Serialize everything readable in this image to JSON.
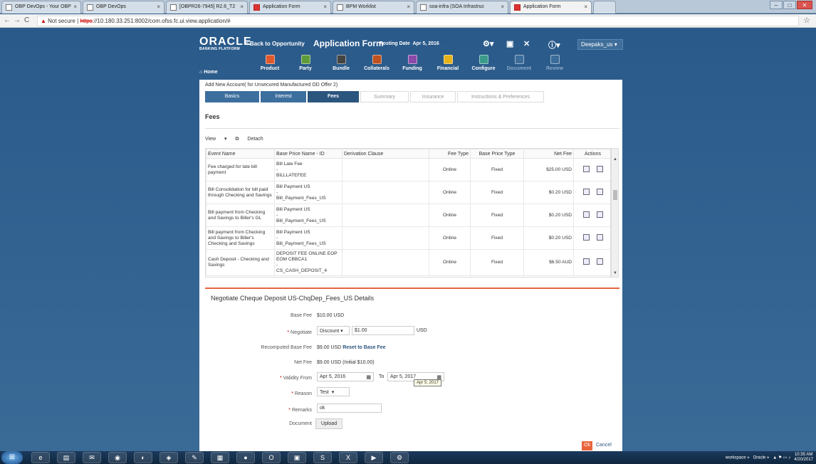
{
  "browser": {
    "tabs": [
      {
        "label": "OBP DevOps - Your OBP"
      },
      {
        "label": "OBP DevOps"
      },
      {
        "label": "[OBPR26-7945] R2.6_T2"
      },
      {
        "label": "Application Form"
      },
      {
        "label": "BPM Worklist"
      },
      {
        "label": "soa-infra (SOA Infrastruc"
      },
      {
        "label": "Application Form"
      }
    ],
    "not_secure": "Not secure",
    "url_scheme": "https",
    "url_rest": "://10.180.33.251:8002/com.ofss.fc.ui.view.application/#"
  },
  "header": {
    "logo": "ORACLE",
    "logo_sub": "BANKING PLATFORM",
    "back": "Back to Opportunity",
    "title": "Application Form",
    "posting_label": "Posting Date",
    "posting_date": "Apr 5, 2016",
    "user": "Deepaks_us",
    "home": "Home",
    "nav": [
      "Product",
      "Party",
      "Bundle",
      "Collaterals",
      "Funding",
      "Financial",
      "Configure",
      "Document",
      "Review"
    ]
  },
  "page": {
    "subheading": "Add New Account( for Unsecured Manufactured OD Offer 2)",
    "steps": [
      "Basics",
      "Interest",
      "Fees",
      "Summary",
      "Insurance",
      "Instructions & Preferences"
    ],
    "section_title": "Fees",
    "toolbar": {
      "view": "View",
      "detach": "Detach"
    }
  },
  "table": {
    "columns": [
      "Event Name",
      "Base Price Name - ID",
      "Derivation Clause",
      "Fee Type",
      "Base Price Type",
      "Net Fee",
      "Actions"
    ],
    "rows": [
      {
        "event": "Fee charged for late bill payment",
        "base_name": "Bill Late Fee",
        "base_id": "BILLLATEFEE",
        "derivation": "",
        "fee_type": "Online",
        "price_type": "Fixed",
        "net_fee": "$25.00 USD"
      },
      {
        "event": "Bill Consolidation for bill paid through Checking and Savings",
        "base_name": "Bill Payment US",
        "base_id": "Bill_Payment_Fees_US",
        "derivation": "",
        "fee_type": "Online",
        "price_type": "Fixed",
        "net_fee": "$0.20 USD"
      },
      {
        "event": "Bill payment from Checking and Savings to Biller's GL",
        "base_name": "Bill Payment US",
        "base_id": "Bill_Payment_Fees_US",
        "derivation": "",
        "fee_type": "Online",
        "price_type": "Fixed",
        "net_fee": "$0.20 USD"
      },
      {
        "event": "Bill payment from Checking and Savings to Biller's Checking and Savings",
        "base_name": "Bill Payment US",
        "base_id": "Bill_Payment_Fees_US",
        "derivation": "",
        "fee_type": "Online",
        "price_type": "Fixed",
        "net_fee": "$0.20 USD"
      },
      {
        "event": "Cash Deposit - Checking and Savings",
        "base_name": "DEPOSIT FEE ONLINE EOP EOM CBBCA1",
        "base_id": "CS_CASH_DEPOSIT_4",
        "derivation": "",
        "fee_type": "Online",
        "price_type": "Fixed",
        "net_fee": "$6.50 AUD"
      }
    ]
  },
  "detail": {
    "title": "Negotiate Cheque Deposit US-ChqDep_Fees_US Details",
    "base_fee_label": "Base Fee",
    "base_fee": "$10.00 USD",
    "negotiate_label": "Negotiate",
    "negotiate_mode": "Discount",
    "negotiate_amount": "$1.00",
    "negotiate_ccy": "USD",
    "recomputed_label": "Recomputed Base Fee",
    "recomputed": "$9.00 USD",
    "reset_link": "Reset to Base Fee",
    "net_fee_label": "Net Fee",
    "net_fee": "$9.00 USD (Initial $10.00)",
    "validity_label": "Validity From",
    "validity_from": "Apr 5, 2016",
    "to_label": "To",
    "validity_to": "Apr 5, 2017",
    "tooltip": "Apr 5, 2017",
    "reason_label": "Reason",
    "reason": "Test",
    "remarks_label": "Remarks",
    "remarks": "ok",
    "document_label": "Document",
    "upload": "Upload",
    "ok": "Ok",
    "cancel": "Cancel"
  },
  "taskbar": {
    "workspace": "workspace",
    "oracle": "Oracle",
    "time": "10:35 AM",
    "date": "4/20/2017"
  },
  "colors": {
    "accent": "#e8643c",
    "nav_blue": "#2b557d",
    "bg_blue": "#2c5c8c"
  }
}
